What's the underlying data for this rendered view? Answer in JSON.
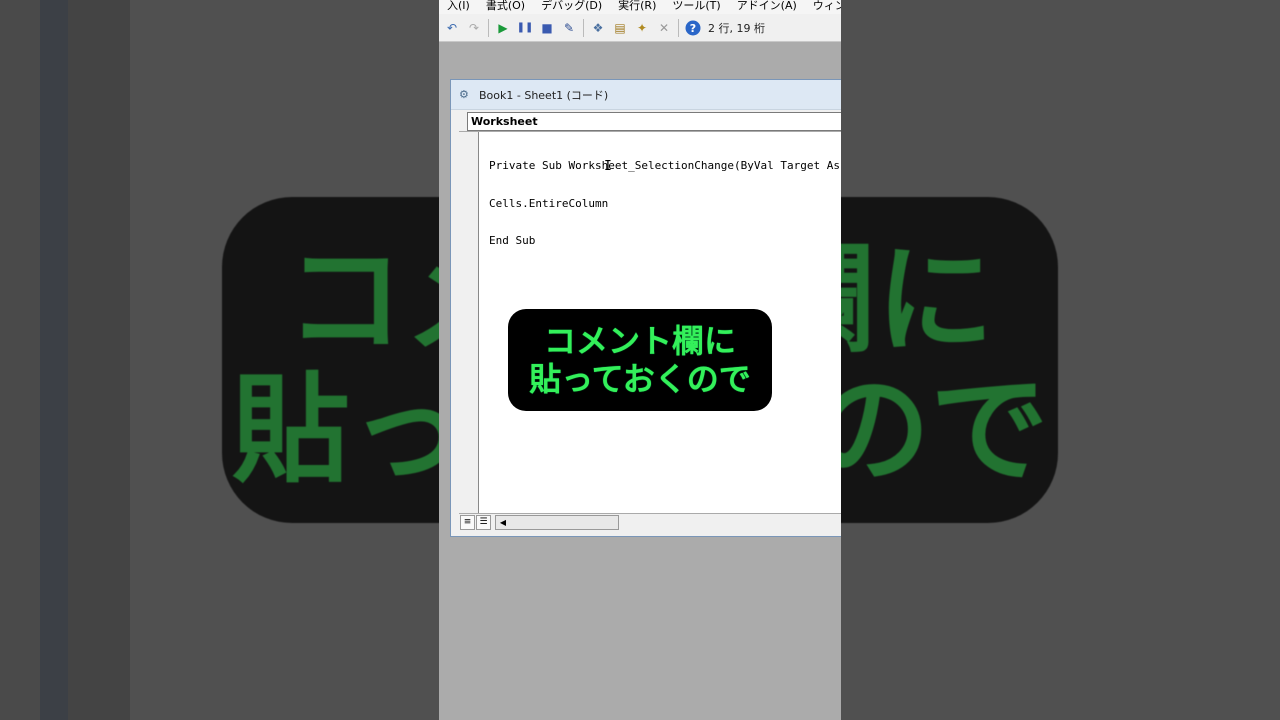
{
  "menu": {
    "items": [
      "入(I)",
      "書式(O)",
      "デバッグ(D)",
      "実行(R)",
      "ツール(T)",
      "アドイン(A)",
      "ウィンドウ(W)"
    ]
  },
  "toolbar": {
    "icons": [
      "undo-icon",
      "redo-icon",
      "run-icon",
      "pause-icon",
      "stop-icon",
      "design-mode-icon",
      "project-explorer-icon",
      "properties-icon",
      "object-browser-icon",
      "toolbox-icon",
      "help-icon"
    ],
    "position": "2 行, 19 桁"
  },
  "code_window": {
    "title": "Book1 - Sheet1 (コード)",
    "object_combo": "Worksheet",
    "code_lines": [
      "Private Sub Worksheet_SelectionChange(ByVal Target As",
      "Cells.EntireColumn",
      "End Sub"
    ]
  },
  "caption": {
    "line1": "コメント欄に",
    "line2": "貼っておくので"
  },
  "colors": {
    "caption_text": "#34f05a",
    "caption_bg": "#000000"
  }
}
